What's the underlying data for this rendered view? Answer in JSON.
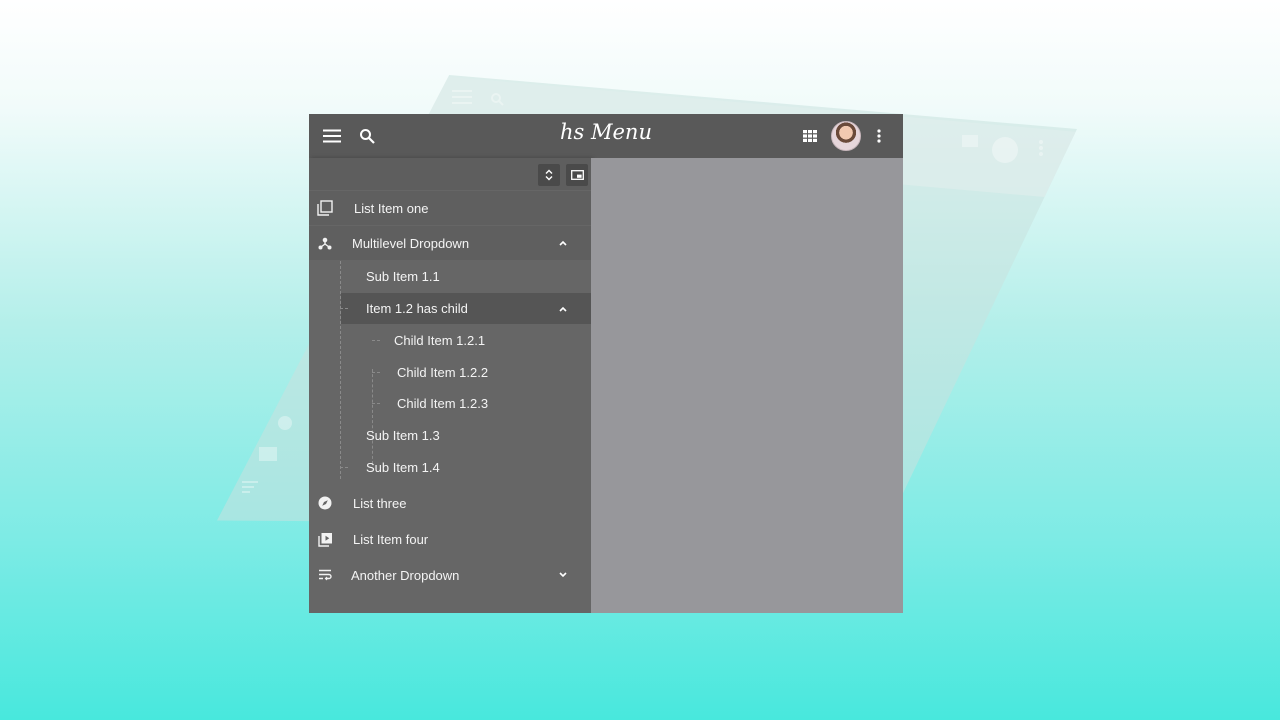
{
  "brand": {
    "title": "hs Menu"
  },
  "topbar": {
    "menu_icon": "hamburger-icon",
    "search_icon": "search-icon",
    "apps_icon": "grid-icon",
    "more_icon": "more-vertical-icon"
  },
  "tools": {
    "expand_icon": "unfold-icon",
    "picture_icon": "picture-in-picture-icon"
  },
  "menu": {
    "item1": "List Item one",
    "multilevel": "Multilevel Dropdown",
    "sub11": "Sub Item 1.1",
    "item12": "Item 1.2 has child",
    "child121": "Child Item 1.2.1",
    "child122": "Child Item 1.2.2",
    "child123": "Child Item 1.2.3",
    "sub13": "Sub Item 1.3",
    "sub14": "Sub Item 1.4",
    "three": "List three",
    "four": "List Item four",
    "another": "Another Dropdown"
  },
  "colors": {
    "topbar": "#595959",
    "sidebar": "#666666",
    "content": "#97979b",
    "active_row": "#555555"
  }
}
